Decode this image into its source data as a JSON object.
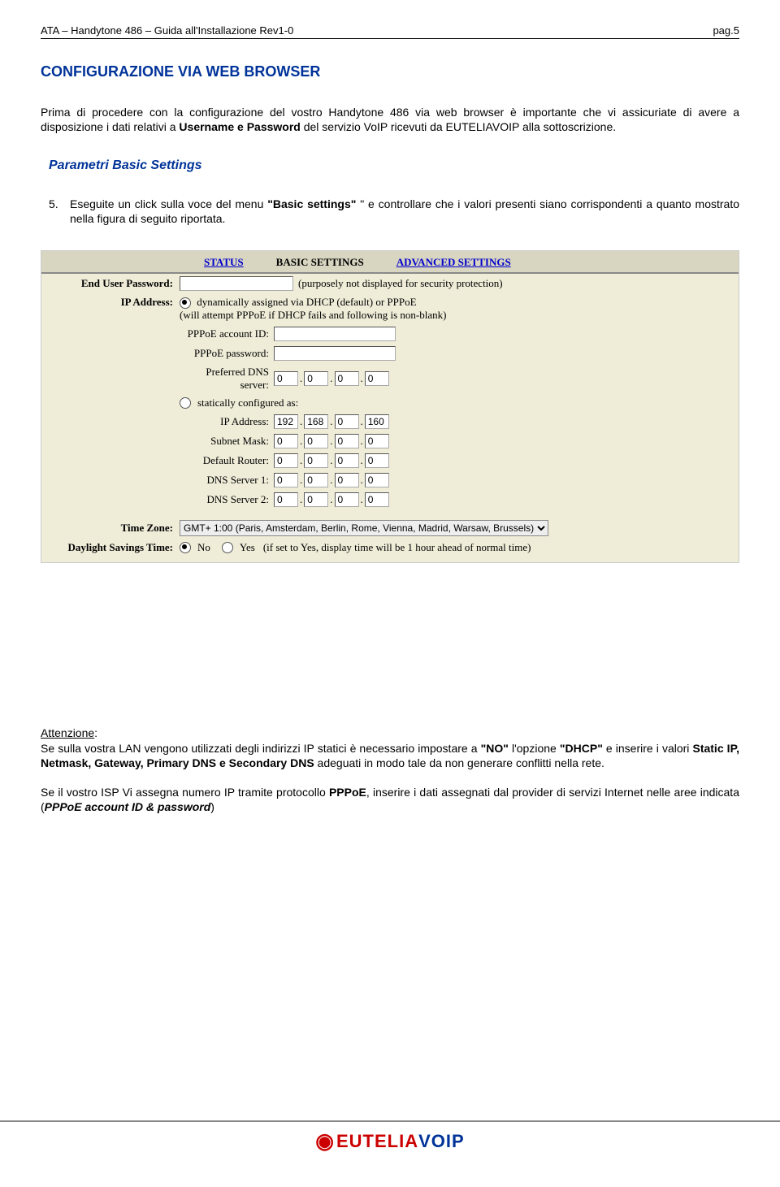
{
  "header": {
    "left": "ATA – Handytone 486 – Guida all'Installazione Rev1-0",
    "right": "pag.5"
  },
  "title": "CONFIGURAZIONE VIA WEB BROWSER",
  "intro_pre": "Prima di procedere con la configurazione del vostro Handytone 486 via web browser è importante che vi assicuriate di avere a disposizione i dati relativi  a ",
  "intro_bold": "Username e Password",
  "intro_post": " del servizio VoIP ricevuti da EUTELIAVOIP alla sottoscrizione.",
  "subsection": "Parametri Basic Settings",
  "step5_num": "5.",
  "step5_a": "Eseguite un click sulla voce  del  menu ",
  "step5_b": "\"Basic settings\"",
  "step5_c": "  \" e controllare che i valori presenti siano corrispondenti a quanto mostrato nella figura di seguito riportata.",
  "shot": {
    "tabs": {
      "status": "STATUS",
      "basic": "BASIC SETTINGS",
      "advanced": "ADVANCED SETTINGS"
    },
    "password_lbl": "End User Password:",
    "password_hint": "(purposely not displayed for security protection)",
    "ip_lbl": "IP Address:",
    "dhcp_line": "dynamically assigned via DHCP (default) or PPPoE",
    "dhcp_note": "(will attempt PPPoE if DHCP fails and following is non-blank)",
    "pppoe_id_lbl": "PPPoE account ID:",
    "pppoe_pw_lbl": "PPPoE password:",
    "pref_dns_lbl": "Preferred DNS server:",
    "pref_dns": [
      "0",
      "0",
      "0",
      "0"
    ],
    "static_line": "statically configured as:",
    "fields": {
      "ip": {
        "lbl": "IP Address:",
        "v": [
          "192",
          "168",
          "0",
          "160"
        ]
      },
      "mask": {
        "lbl": "Subnet Mask:",
        "v": [
          "0",
          "0",
          "0",
          "0"
        ]
      },
      "gw": {
        "lbl": "Default Router:",
        "v": [
          "0",
          "0",
          "0",
          "0"
        ]
      },
      "dns1": {
        "lbl": "DNS Server 1:",
        "v": [
          "0",
          "0",
          "0",
          "0"
        ]
      },
      "dns2": {
        "lbl": "DNS Server 2:",
        "v": [
          "0",
          "0",
          "0",
          "0"
        ]
      }
    },
    "tz_lbl": "Time Zone:",
    "tz_val": "GMT+ 1:00 (Paris, Amsterdam, Berlin, Rome, Vienna, Madrid, Warsaw, Brussels)",
    "dst_lbl": "Daylight Savings Time:",
    "dst_no": "No",
    "dst_yes": "Yes",
    "dst_hint": "(if set to Yes, display time will be 1 hour ahead of normal time)"
  },
  "attn_label": "Attenzione",
  "attn_p1_a": "Se sulla vostra LAN vengono utilizzati degli indirizzi IP statici è necessario impostare a ",
  "attn_p1_no": "\"NO\"",
  "attn_p1_b": " l'opzione ",
  "attn_p1_dhcp": "\"DHCP\"",
  "attn_p1_c": "  e inserire i valori ",
  "attn_p1_fields": "Static IP, Netmask, Gateway, Primary DNS e Secondary DNS",
  "attn_p1_d": " adeguati in modo tale da non generare conflitti nella rete.",
  "attn_p2_a": "Se il vostro ISP Vi assegna numero IP tramite protocollo ",
  "attn_p2_ppp": "PPPoE",
  "attn_p2_b": ", inserire i dati assegnati dal provider di servizi Internet nelle aree indicata (",
  "attn_p2_fields": "PPPoE account ID  & password",
  "attn_p2_c": ")",
  "logo": {
    "e": "EUTELIA",
    "v": "VOIP"
  }
}
